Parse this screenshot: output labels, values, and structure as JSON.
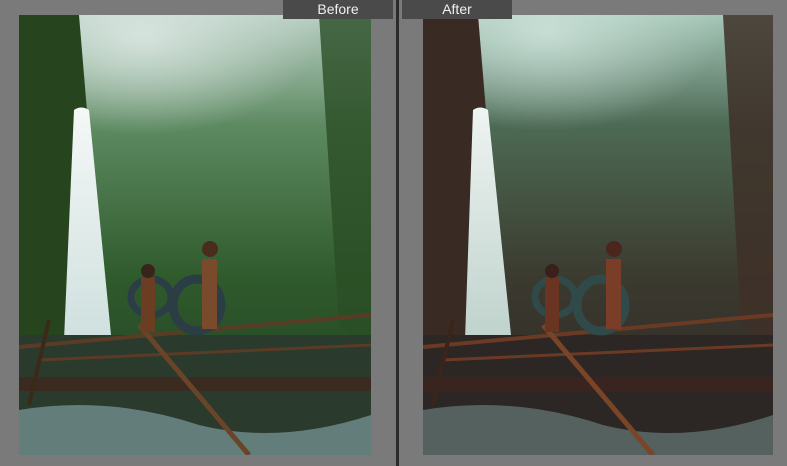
{
  "comparison": {
    "before": {
      "label": "Before",
      "image_description": "waterfall-jungle-photo-original"
    },
    "after": {
      "label": "After",
      "image_description": "waterfall-jungle-photo-edited"
    }
  },
  "colors": {
    "background": "#7a7a7a",
    "label_bg": "#4a4a4a",
    "divider": "#2b2b2b"
  }
}
